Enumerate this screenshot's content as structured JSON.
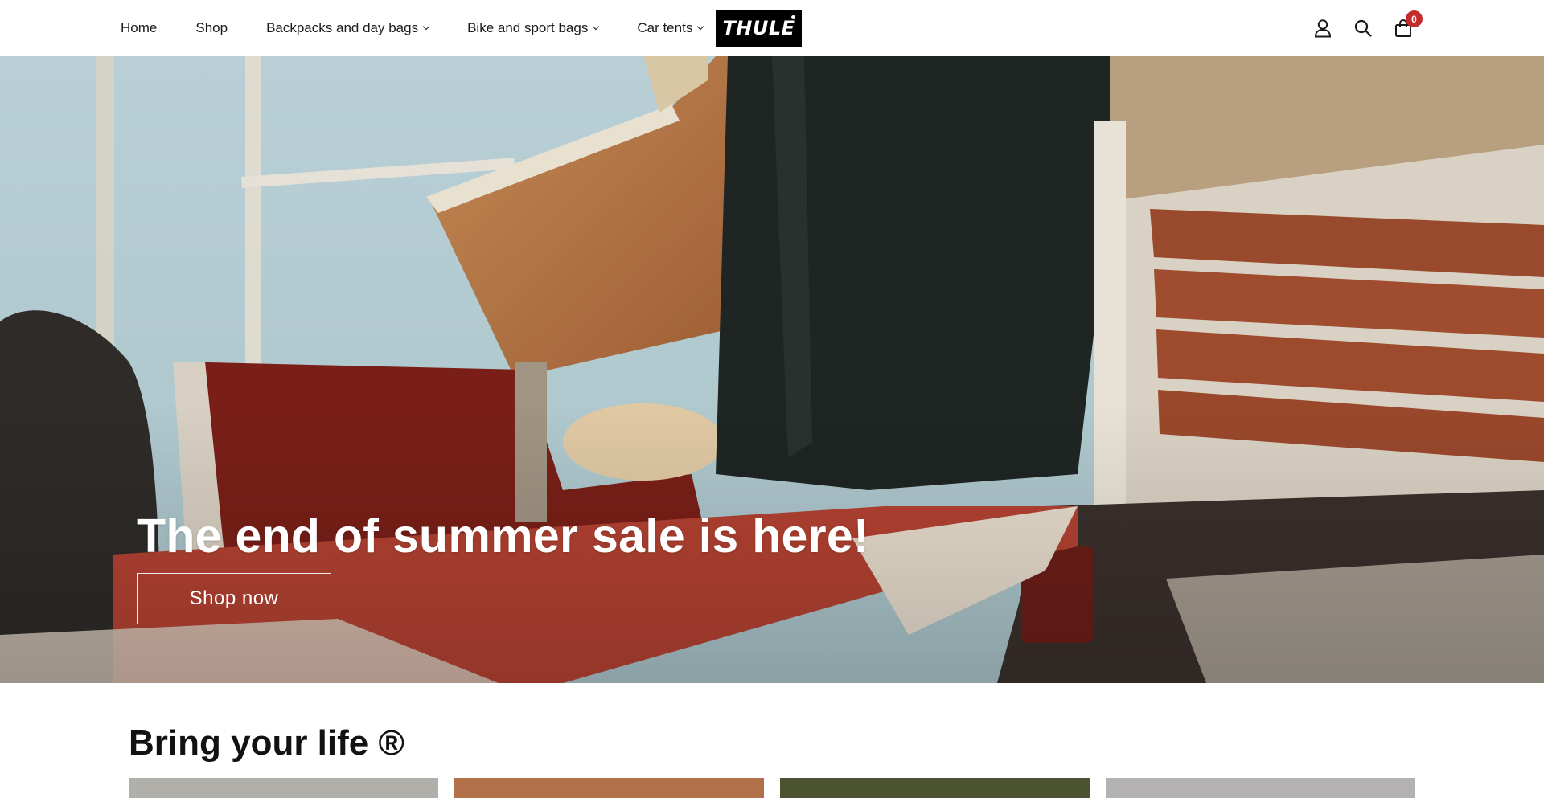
{
  "header": {
    "nav": [
      {
        "label": "Home",
        "has_dropdown": false
      },
      {
        "label": "Shop",
        "has_dropdown": false
      },
      {
        "label": "Backpacks and day bags",
        "has_dropdown": true
      },
      {
        "label": "Bike and sport bags",
        "has_dropdown": true
      },
      {
        "label": "Car tents",
        "has_dropdown": true
      }
    ],
    "logo_text": "THULE",
    "icons": [
      "account-icon",
      "search-icon",
      "cart-icon"
    ],
    "cart_count": "0"
  },
  "hero": {
    "title": "The end of summer sale is here!",
    "cta_label": "Shop now"
  },
  "section": {
    "title": "Bring your life ®",
    "cards": [
      {
        "color": "#b0afa9"
      },
      {
        "color": "#b2714a"
      },
      {
        "color": "#4b5331"
      },
      {
        "color": "#b3b1b1"
      }
    ]
  },
  "colors": {
    "badge": "#c42c2c",
    "logo_bg": "#000000"
  }
}
